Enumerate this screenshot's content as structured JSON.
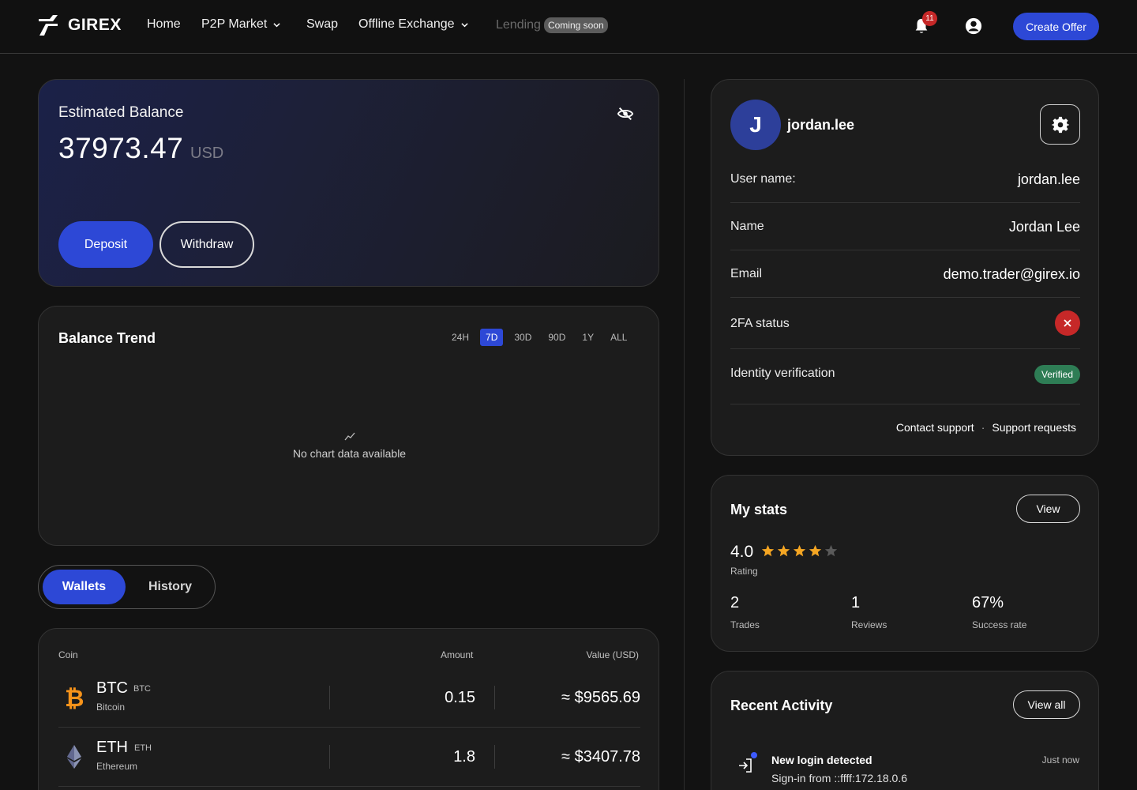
{
  "brand": {
    "name": "GIREX"
  },
  "nav": {
    "home": "Home",
    "p2p": "P2P Market",
    "swap": "Swap",
    "offline": "Offline Exchange",
    "lending": "Lending",
    "lending_badge": "Coming soon",
    "notifications_count": "11",
    "create_offer": "Create Offer"
  },
  "balance": {
    "label": "Estimated Balance",
    "amount": "37973.47",
    "currency": "USD",
    "deposit": "Deposit",
    "withdraw": "Withdraw"
  },
  "trend": {
    "title": "Balance Trend",
    "ranges": [
      "24H",
      "7D",
      "30D",
      "90D",
      "1Y",
      "ALL"
    ],
    "active_range": "7D",
    "empty": "No chart data available"
  },
  "tabs": {
    "wallets": "Wallets",
    "history": "History",
    "active": "Wallets"
  },
  "wallets": {
    "headers": {
      "coin": "Coin",
      "amount": "Amount",
      "value": "Value (USD)"
    },
    "rows": [
      {
        "symbol": "BTC",
        "ticker": "BTC",
        "name": "Bitcoin",
        "amount": "0.15",
        "value": "≈ $9565.69"
      },
      {
        "symbol": "ETH",
        "ticker": "ETH",
        "name": "Ethereum",
        "amount": "1.8",
        "value": "≈ $3407.78"
      }
    ]
  },
  "profile": {
    "initial": "J",
    "handle": "jordan.lee",
    "rows": {
      "username_label": "User name:",
      "username_value": "jordan.lee",
      "name_label": "Name",
      "name_value": "Jordan Lee",
      "email_label": "Email",
      "email_value": "demo.trader@girex.io",
      "twofa_label": "2FA status",
      "identity_label": "Identity verification",
      "identity_value": "Verified"
    },
    "contact_support": "Contact support",
    "support_requests": "Support requests",
    "separator": "·"
  },
  "stats": {
    "title": "My stats",
    "view": "View",
    "rating": "4.0",
    "rating_stars": 4,
    "rating_label": "Rating",
    "trades": "2",
    "trades_label": "Trades",
    "reviews": "1",
    "reviews_label": "Reviews",
    "success": "67%",
    "success_label": "Success rate"
  },
  "activity": {
    "title": "Recent Activity",
    "view_all": "View all",
    "items": [
      {
        "title": "New login detected",
        "desc": "Sign-in from ::ffff:172.18.0.6",
        "time": "Just now"
      }
    ]
  },
  "colors": {
    "accent": "#2d48d6",
    "danger": "#c62828",
    "success": "#2e7d55",
    "star": "#f5a623"
  }
}
